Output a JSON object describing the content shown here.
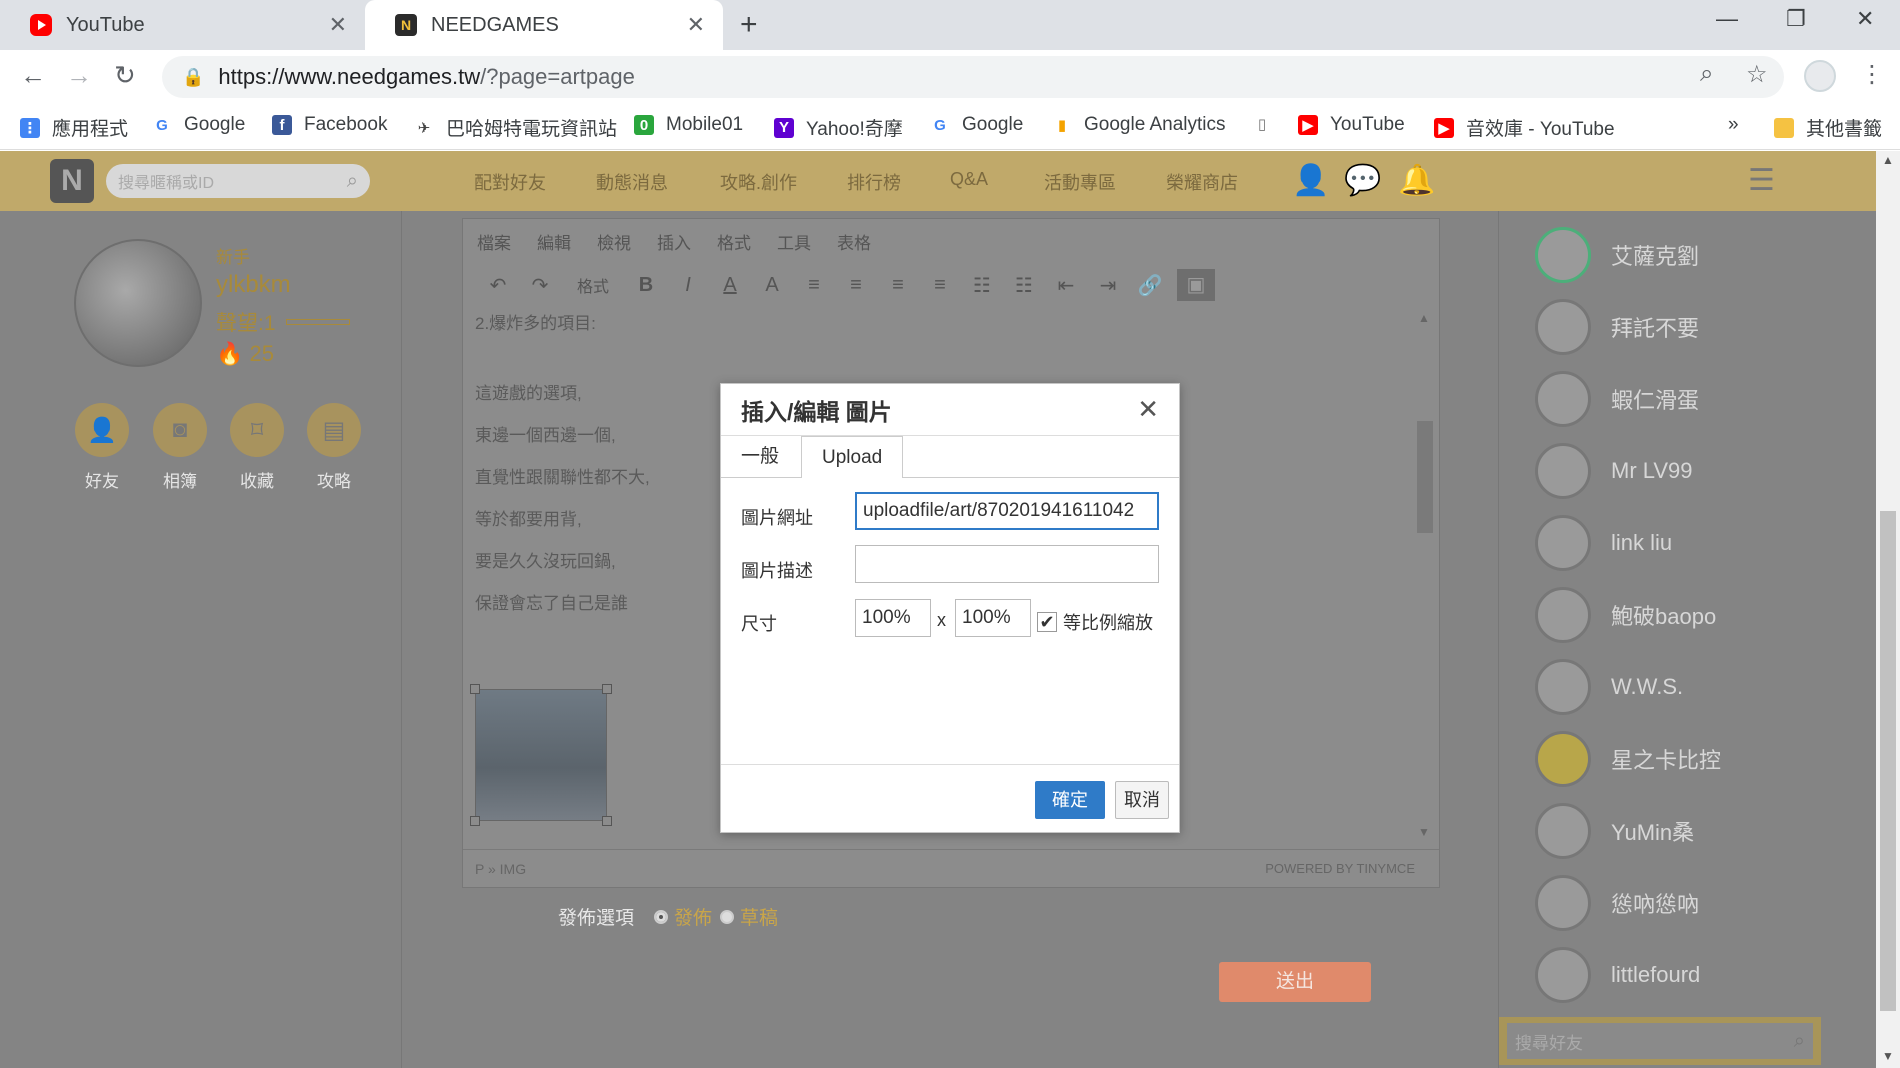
{
  "browser": {
    "tabs": [
      {
        "title": "YouTube"
      },
      {
        "title": "NEEDGAMES"
      }
    ],
    "url_host": "https://www.needgames.tw",
    "url_rest": "/?page=artpage",
    "bookmarks": [
      {
        "label": "應用程式",
        "icon": "apps-grid-icon"
      },
      {
        "label": "Google",
        "icon": "google-icon"
      },
      {
        "label": "Facebook",
        "icon": "facebook-icon"
      },
      {
        "label": "巴哈姆特電玩資訊站",
        "icon": "bahamut-icon"
      },
      {
        "label": "Mobile01",
        "icon": "mobile01-icon"
      },
      {
        "label": "Yahoo!奇摩",
        "icon": "yahoo-icon"
      },
      {
        "label": "Google",
        "icon": "google-icon"
      },
      {
        "label": "Google Analytics",
        "icon": "analytics-icon"
      },
      {
        "label": "YouTube",
        "icon": "youtube-icon"
      },
      {
        "label": "音效庫 - YouTube",
        "icon": "youtube-icon"
      },
      {
        "label": "其他書籤",
        "icon": "folder-icon"
      }
    ],
    "more": "»"
  },
  "site": {
    "search_placeholder": "搜尋暱稱或ID",
    "nav": [
      "配對好友",
      "動態消息",
      "攻略.創作",
      "排行榜",
      "Q&A",
      "活動專區",
      "榮耀商店"
    ],
    "user": {
      "rank": "新手",
      "name": "ylkbkm",
      "reputation": "聲望:1",
      "fire_count": "25"
    },
    "quick_links": [
      "好友",
      "相簿",
      "收藏",
      "攻略"
    ],
    "friends": [
      "艾薩克劉",
      "拜託不要",
      "蝦仁滑蛋",
      "Mr LV99",
      "link liu",
      "鮑破baopo",
      "W.W.S.",
      "星之卡比控",
      "YuMin桑",
      "慫吶慫吶",
      "littlefourd"
    ],
    "friend_search_placeholder": "搜尋好友",
    "publish_label": "發佈選項",
    "publish_options": [
      "發佈",
      "草稿"
    ],
    "submit": "送出"
  },
  "editor": {
    "menu": [
      "檔案",
      "編輯",
      "檢視",
      "插入",
      "格式",
      "工具",
      "表格"
    ],
    "format_label": "格式",
    "content_lines": [
      "2.爆炸多的項目:",
      "這遊戲的選項,",
      "東邊一個西邊一個,",
      "直覺性跟關聯性都不大,",
      "等於都要用背,",
      "要是久久沒玩回鍋,",
      "保證會忘了自己是誰"
    ],
    "path": "P » IMG",
    "powered": "POWERED BY TINYMCE"
  },
  "dialog": {
    "title": "插入/編輯 圖片",
    "tabs": [
      "一般",
      "Upload"
    ],
    "url_label": "圖片網址",
    "url_value": "uploadfile/art/870201941611042",
    "desc_label": "圖片描述",
    "desc_value": "",
    "size_label": "尺寸",
    "width": "100%",
    "height": "100%",
    "size_sep": "x",
    "constrain_label": "等比例縮放",
    "constrain_checked": true,
    "ok": "確定",
    "cancel": "取消"
  }
}
